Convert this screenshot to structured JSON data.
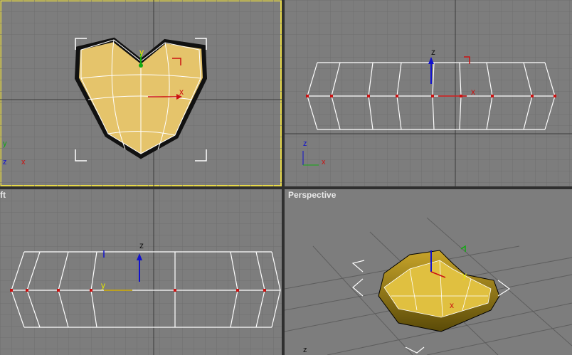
{
  "viewports": [
    {
      "id": "top",
      "label": "",
      "active": true,
      "axes": [
        "y",
        "x"
      ]
    },
    {
      "id": "front",
      "label": "",
      "active": false,
      "axes": [
        "z",
        "x"
      ]
    },
    {
      "id": "left",
      "label": "ft",
      "active": false,
      "axes": [
        "z",
        "y"
      ]
    },
    {
      "id": "perspective",
      "label": "Perspective",
      "active": false,
      "axes": [
        "z"
      ]
    }
  ],
  "gizmo_labels": {
    "x": "x",
    "y": "y",
    "z": "z"
  },
  "colors": {
    "viewport_bg": "#7d7d7d",
    "grid": "#6f6f6f",
    "grid_major": "#555555",
    "heart_fill": "#e5c46b",
    "heart_edge": "#ffffff",
    "active_border": "#e6d84a",
    "axis_x": "#cc1111",
    "axis_y": "#11aa11",
    "axis_z": "#1111cc"
  }
}
